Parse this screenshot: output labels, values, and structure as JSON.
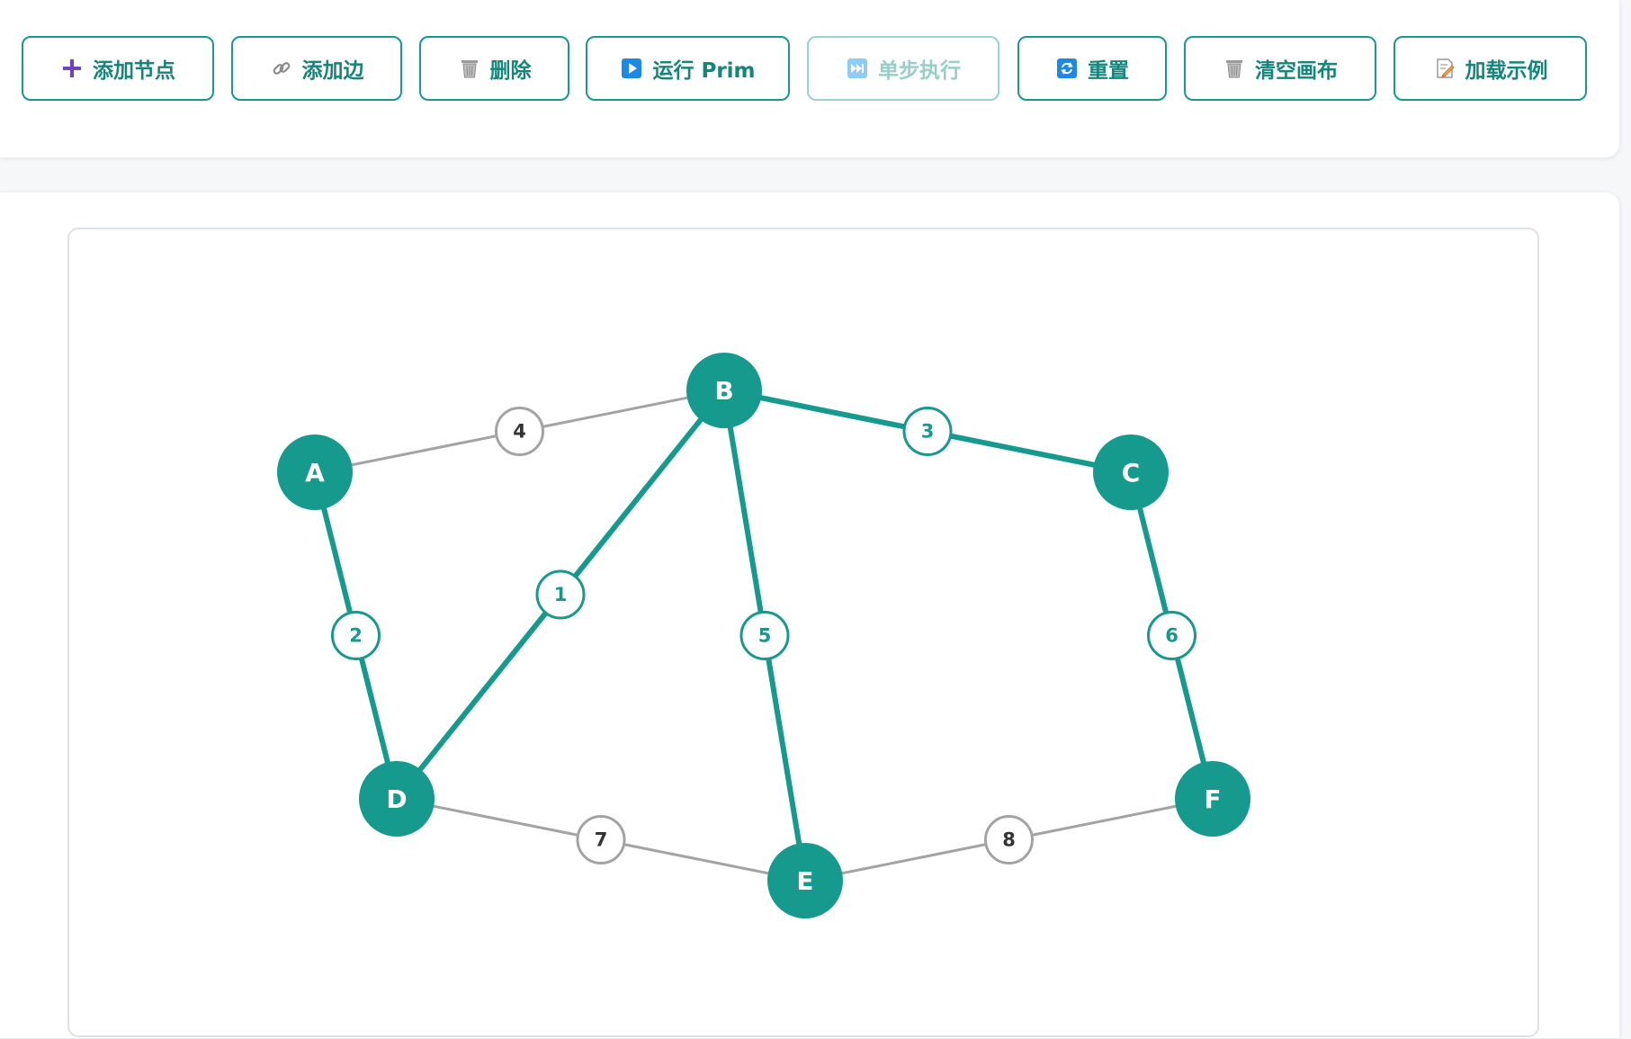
{
  "toolbar": {
    "buttons": [
      {
        "id": "add-node",
        "label": "添加节点",
        "icon": "plus-icon",
        "disabled": false
      },
      {
        "id": "add-edge",
        "label": "添加边",
        "icon": "link-icon",
        "disabled": false
      },
      {
        "id": "delete",
        "label": "删除",
        "icon": "trash-icon",
        "disabled": false
      },
      {
        "id": "run-prim",
        "label": "运行 Prim",
        "icon": "play-icon",
        "disabled": false
      },
      {
        "id": "step",
        "label": "单步执行",
        "icon": "fast-forward-icon",
        "disabled": true
      },
      {
        "id": "reset",
        "label": "重置",
        "icon": "refresh-icon",
        "disabled": false
      },
      {
        "id": "clear-canvas",
        "label": "清空画布",
        "icon": "trash-icon",
        "disabled": false
      },
      {
        "id": "load-example",
        "label": "加载示例",
        "icon": "memo-icon",
        "disabled": false
      }
    ]
  },
  "graph": {
    "nodes": [
      {
        "id": "A",
        "label": "A"
      },
      {
        "id": "B",
        "label": "B"
      },
      {
        "id": "C",
        "label": "C"
      },
      {
        "id": "D",
        "label": "D"
      },
      {
        "id": "E",
        "label": "E"
      },
      {
        "id": "F",
        "label": "F"
      }
    ],
    "edges": [
      {
        "from": "A",
        "to": "B",
        "weight": "4",
        "in_mst": false
      },
      {
        "from": "B",
        "to": "C",
        "weight": "3",
        "in_mst": true
      },
      {
        "from": "A",
        "to": "D",
        "weight": "2",
        "in_mst": true
      },
      {
        "from": "B",
        "to": "D",
        "weight": "1",
        "in_mst": true
      },
      {
        "from": "B",
        "to": "E",
        "weight": "5",
        "in_mst": true
      },
      {
        "from": "C",
        "to": "F",
        "weight": "6",
        "in_mst": true
      },
      {
        "from": "D",
        "to": "E",
        "weight": "7",
        "in_mst": false
      },
      {
        "from": "E",
        "to": "F",
        "weight": "8",
        "in_mst": false
      }
    ]
  },
  "colors": {
    "accent": "#159a8d",
    "node_fill": "#159a8d",
    "mst_edge": "#159a8d",
    "normal_edge": "#a3a3a3",
    "normal_weight_text": "#333333",
    "icon_purple": "#6f42c1",
    "icon_blue": "#1e88e5",
    "icon_gray": "#8a8a8a"
  }
}
